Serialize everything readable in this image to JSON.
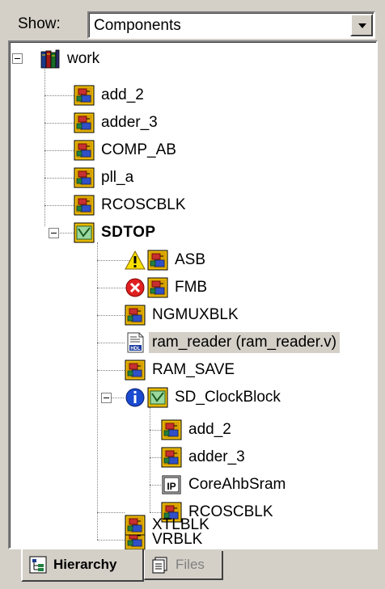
{
  "show": {
    "label": "Show:",
    "value": "Components"
  },
  "tree": {
    "root": {
      "label": "work"
    },
    "items": [
      {
        "label": "add_2"
      },
      {
        "label": "adder_3"
      },
      {
        "label": "COMP_AB"
      },
      {
        "label": "pll_a"
      },
      {
        "label": "RCOSCBLK"
      }
    ],
    "sdtop": {
      "label": "SDTOP",
      "children": [
        {
          "label": "ASB",
          "status": "warning-icon"
        },
        {
          "label": "FMB",
          "status": "error-icon"
        },
        {
          "label": "NGMUXBLK"
        },
        {
          "label": "ram_reader (ram_reader.v)",
          "icon": "hdl-file-icon",
          "selected": true
        },
        {
          "label": "RAM_SAVE"
        }
      ],
      "clock": {
        "label": "SD_ClockBlock",
        "status": "info-icon",
        "children": [
          {
            "label": "add_2"
          },
          {
            "label": "adder_3"
          },
          {
            "label": "CoreAhbSram",
            "icon": "ip-icon"
          },
          {
            "label": "RCOSCBLK"
          }
        ]
      },
      "after": [
        {
          "label": "VRBLK"
        },
        {
          "label": "XTLBLK"
        }
      ]
    }
  },
  "tabs": [
    {
      "label": "Hierarchy",
      "active": true
    },
    {
      "label": "Files",
      "active": false
    }
  ],
  "colors": {
    "background": "#d4d0c8",
    "component_red": "#c83030",
    "component_yellow": "#f0c000",
    "selection": "#d4d0c8"
  }
}
